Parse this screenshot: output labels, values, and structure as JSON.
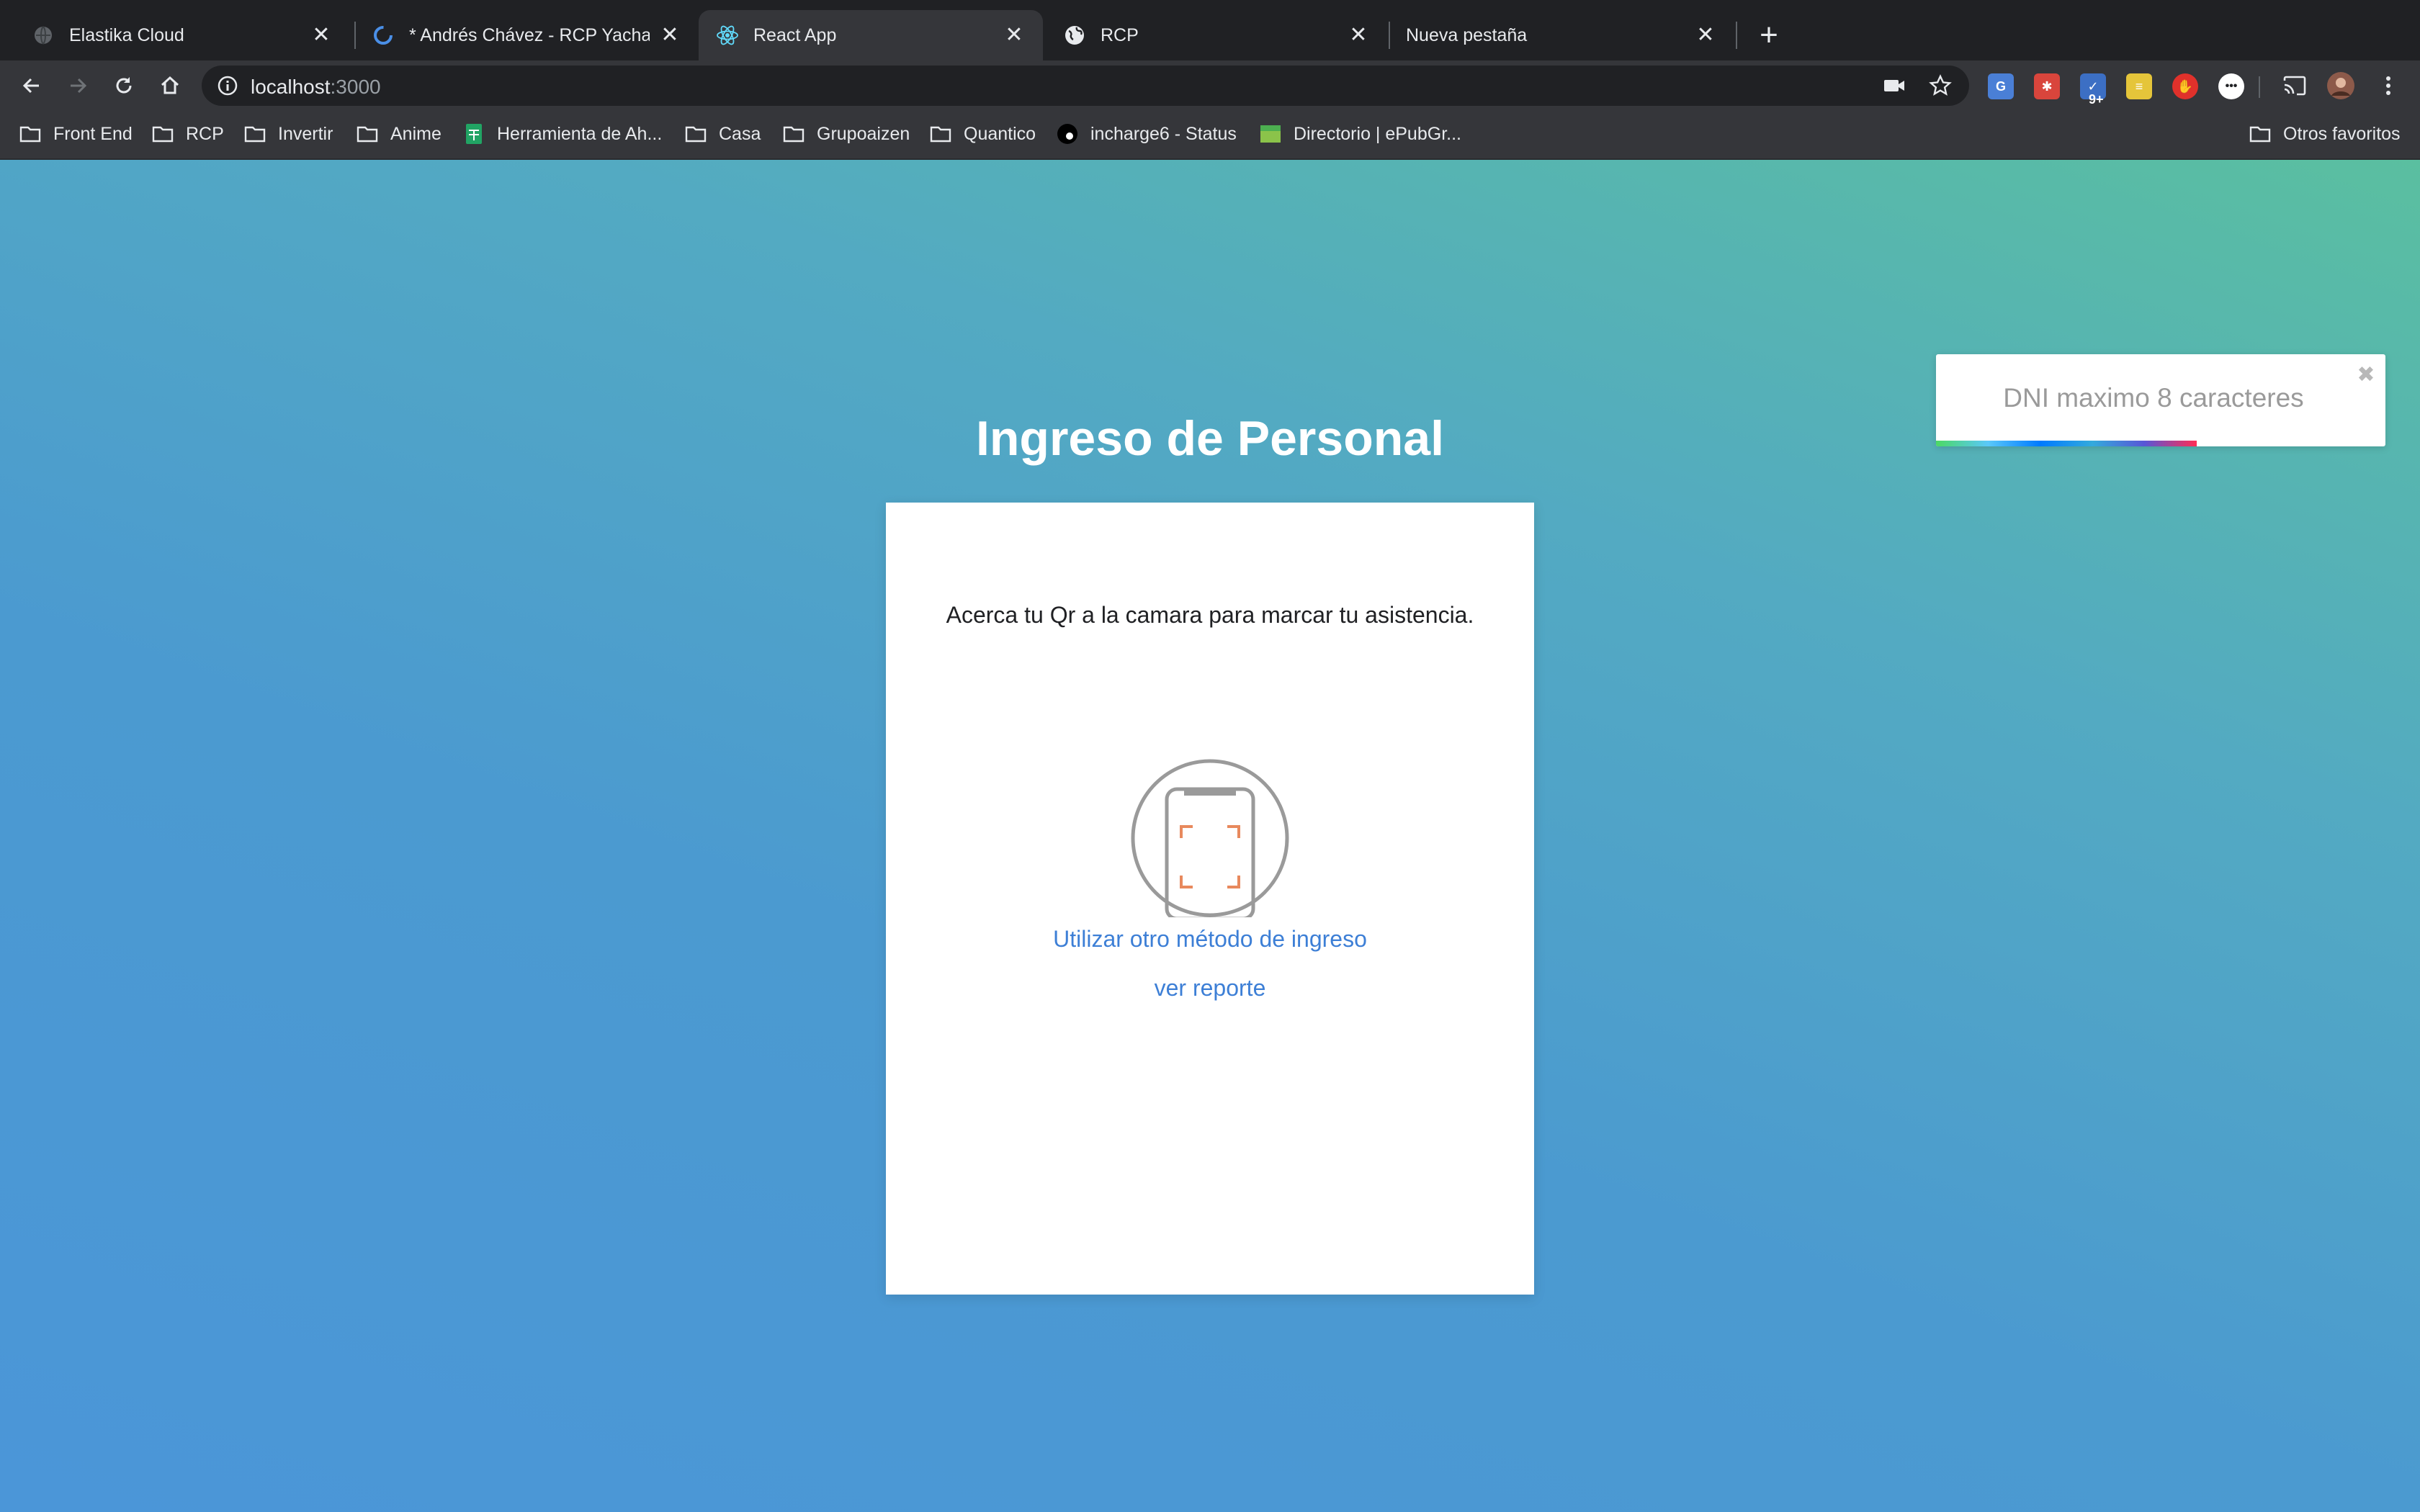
{
  "browser": {
    "tabs": [
      {
        "title": "Elastika Cloud",
        "favicon": "globe-icon",
        "active": false
      },
      {
        "title": "* Andrés Chávez - RCP Yachay M",
        "favicon": "loading-icon",
        "active": false
      },
      {
        "title": "React App",
        "favicon": "react-icon",
        "active": true
      },
      {
        "title": "RCP",
        "favicon": "globe-icon",
        "active": false
      },
      {
        "title": "Nueva pestaña",
        "favicon": "",
        "active": false
      }
    ],
    "close_glyph": "✕",
    "new_tab_glyph": "+",
    "address": {
      "host": "localhost",
      "port": ":3000"
    },
    "extensions": [
      {
        "name": "translate-extension-icon",
        "color": "#4a7fd6"
      },
      {
        "name": "bug-extension-icon",
        "color": "#d9453c"
      },
      {
        "name": "tasks-extension-icon",
        "color": "#3c6fc4",
        "badge": "9+"
      },
      {
        "name": "notes-extension-icon",
        "color": "#e5c53a"
      },
      {
        "name": "stop-extension-icon",
        "color": "#e0312b"
      },
      {
        "name": "circle-extension-icon",
        "color": "#ffffff"
      }
    ],
    "bookmarks": [
      {
        "label": "Front End",
        "icon": "folder-icon"
      },
      {
        "label": "RCP",
        "icon": "folder-icon"
      },
      {
        "label": "Invertir",
        "icon": "folder-icon"
      },
      {
        "label": "Anime",
        "icon": "folder-icon"
      },
      {
        "label": "Herramienta de Ah...",
        "icon": "sheets-icon"
      },
      {
        "label": "Casa",
        "icon": "folder-icon"
      },
      {
        "label": "Grupoaizen",
        "icon": "folder-icon"
      },
      {
        "label": "Quantico",
        "icon": "folder-icon"
      },
      {
        "label": "incharge6 - Status",
        "icon": "status-icon"
      },
      {
        "label": "Directorio | ePubGr...",
        "icon": "epub-icon"
      }
    ],
    "other_bookmarks": "Otros favoritos"
  },
  "page": {
    "title": "Ingreso de Personal",
    "instruction": "Acerca tu Qr a la camara para marcar tu asistencia.",
    "links": {
      "other_method": "Utilizar otro método de ingreso",
      "report": "ver reporte"
    },
    "link_color": "#3d7fd6"
  },
  "toast": {
    "message": "DNI maximo 8 caracteres",
    "close_glyph": "✖",
    "progress": 0.58
  }
}
